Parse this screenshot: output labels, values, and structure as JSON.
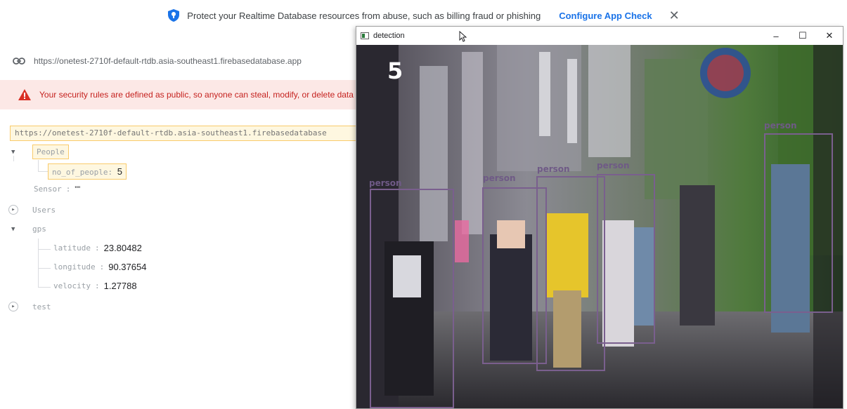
{
  "banner": {
    "message": "Protect your Realtime Database resources from abuse, such as billing fraud or phishing",
    "link_label": "Configure App Check",
    "close_glyph": "✕",
    "icon": "shield-icon"
  },
  "database": {
    "url": "https://onetest-2710f-default-rtdb.asia-southeast1.firebasedatabase.app",
    "root_url": "https://onetest-2710f-default-rtdb.asia-southeast1.firebasedatabase",
    "warning": "Your security rules are defined as public, so anyone can steal, modify, or delete data"
  },
  "tree": {
    "people": {
      "key": "People",
      "child_key": "no_of_people",
      "child_value": "5"
    },
    "sensor": {
      "key": "Sensor",
      "value": "\"\""
    },
    "users": {
      "key": "Users"
    },
    "gps": {
      "key": "gps",
      "latitude_key": "latitude",
      "latitude_value": "23.80482",
      "longitude_key": "longitude",
      "longitude_value": "90.37654",
      "velocity_key": "velocity",
      "velocity_value": "1.27788"
    },
    "test": {
      "key": "test"
    }
  },
  "detection_window": {
    "title": "detection",
    "minimize_glyph": "–",
    "maximize_glyph": "☐",
    "close_glyph": "✕",
    "people_count": "5",
    "box_label": "person",
    "box_color": "#7a5f8e"
  }
}
